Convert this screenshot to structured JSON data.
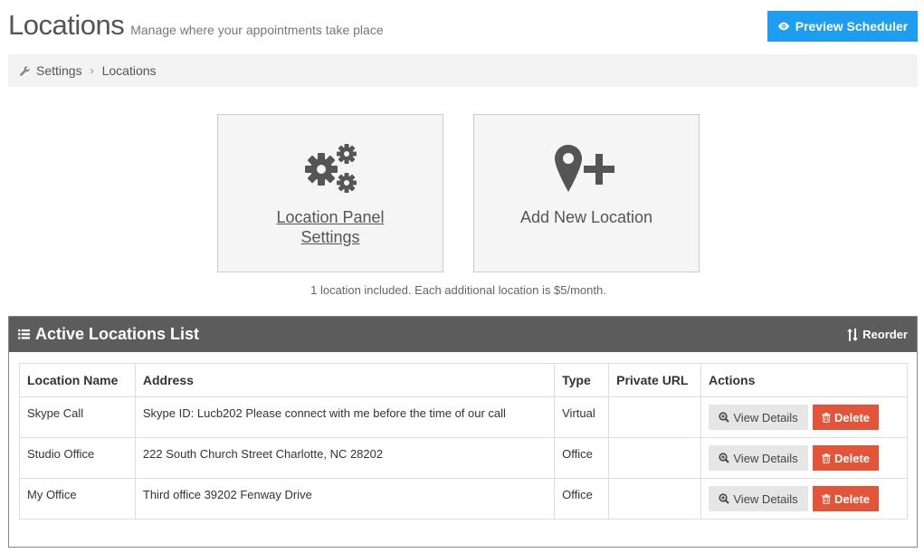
{
  "header": {
    "title": "Locations",
    "subtitle": "Manage where your appointments take place",
    "preview_button": "Preview Scheduler"
  },
  "breadcrumb": {
    "items": [
      "Settings",
      "Locations"
    ]
  },
  "cards": {
    "settings_label": "Location Panel Settings",
    "add_label": "Add New Location"
  },
  "pricing_note": "1 location included. Each additional location is $5/month.",
  "list": {
    "title": "Active Locations List",
    "reorder_label": "Reorder",
    "columns": [
      "Location Name",
      "Address",
      "Type",
      "Private URL",
      "Actions"
    ],
    "rows": [
      {
        "name": "Skype Call",
        "address": "Skype ID: Lucb202 Please connect with me before the time of our call",
        "type": "Virtual",
        "private_url": ""
      },
      {
        "name": "Studio Office",
        "address": "222 South Church Street Charlotte, NC 28202",
        "type": "Office",
        "private_url": ""
      },
      {
        "name": "My Office",
        "address": "Third office 39202 Fenway Drive",
        "type": "Office",
        "private_url": ""
      }
    ],
    "view_label": "View Details",
    "delete_label": "Delete"
  },
  "colors": {
    "accent": "#1e9ef0",
    "danger": "#e35438",
    "panel_header": "#5c5c5c"
  }
}
